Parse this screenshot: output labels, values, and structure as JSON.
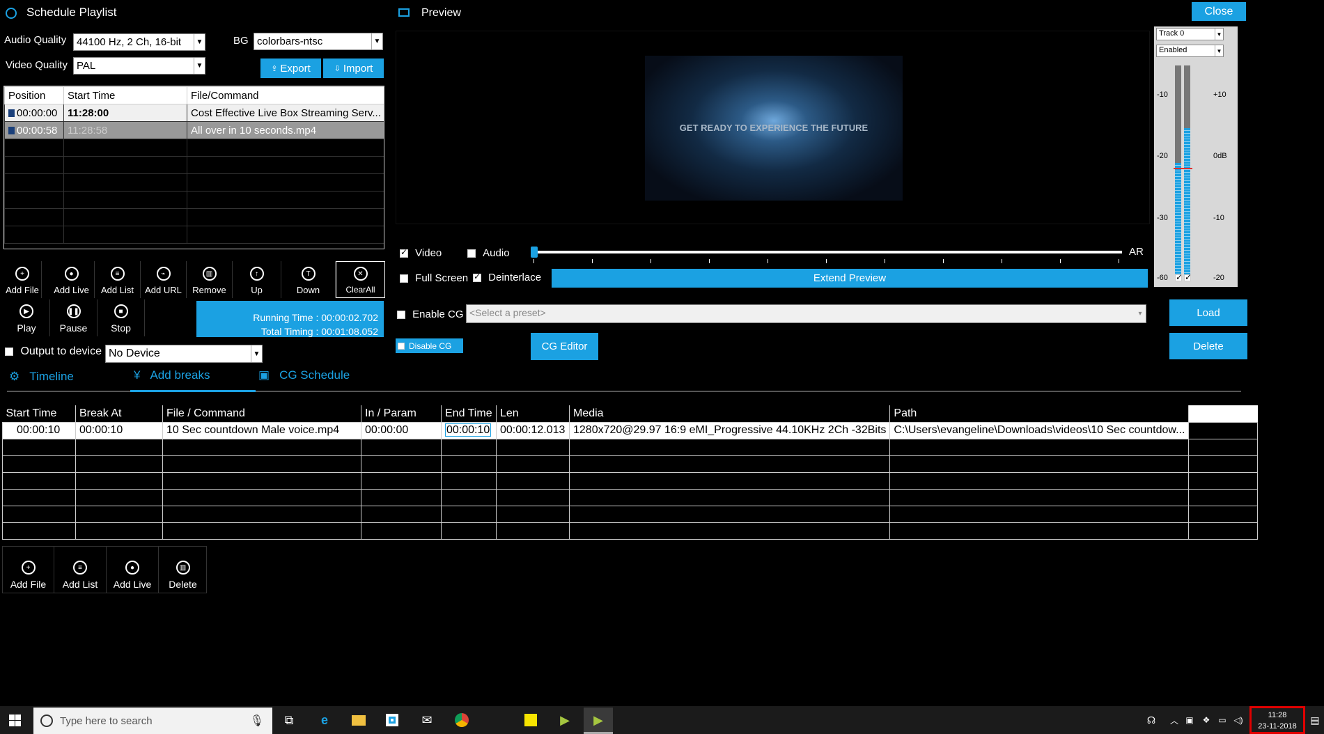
{
  "window": {
    "title": "Schedule Playlist",
    "preview_title": "Preview",
    "close_label": "Close"
  },
  "settings": {
    "audio_quality_label": "Audio Quality",
    "audio_quality_value": "44100 Hz, 2 Ch, 16-bit",
    "bg_label": "BG",
    "bg_value": "colorbars-ntsc",
    "video_quality_label": "Video Quality",
    "video_quality_value": "PAL",
    "export_label": "Export",
    "import_label": "Import"
  },
  "playlist": {
    "columns": [
      "Position",
      "Start Time",
      "File/Command"
    ],
    "rows": [
      {
        "position": "00:00:00",
        "start": "11:28:00",
        "file": "Cost Effective Live Box Streaming Serv..."
      },
      {
        "position": "00:00:58",
        "start": "11:28:58",
        "file": "All over in 10 seconds.mp4"
      }
    ]
  },
  "playlist_tools": [
    "Add File",
    "Add Live",
    "Add List",
    "Add URL",
    "Remove",
    "Up",
    "Down",
    "ClearAll"
  ],
  "transport": [
    "Play",
    "Pause",
    "Stop"
  ],
  "timing": {
    "running": "Running Time : 00:00:02.702",
    "total": "Total Timing : 00:01:08.052"
  },
  "output": {
    "label": "Output to device",
    "device": "No Device"
  },
  "tabs": [
    "Timeline",
    "Add breaks",
    "CG Schedule"
  ],
  "preview": {
    "video_text": "GET READY TO EXPERIENCE THE FUTURE",
    "video_label": "Video",
    "audio_label": "Audio",
    "ar_label": "AR",
    "fullscreen_label": "Full Screen",
    "deinterlace_label": "Deinterlace",
    "extend_preview_label": "Extend Preview",
    "enable_cg_label": "Enable CG",
    "preset_placeholder": "<Select a preset>",
    "disable_cg_label": "Disable CG",
    "cg_editor_label": "CG Editor",
    "load_label": "Load",
    "delete_label": "Delete"
  },
  "meter": {
    "track": "Track 0",
    "enabled": "Enabled",
    "left_scale": [
      "-10",
      "-20",
      "-30",
      "-60"
    ],
    "right_scale": [
      "+10",
      "0dB",
      "-10",
      "-20"
    ]
  },
  "breaks": {
    "columns": [
      "Start Time",
      "Break At",
      "File / Command",
      "In / Param",
      "End Time",
      "Len",
      "Media",
      "Path"
    ],
    "rows": [
      {
        "start": "00:00:10",
        "break_at": "00:00:10",
        "file": "10 Sec countdown Male voice.mp4",
        "in": "00:00:00",
        "end": "00:00:10",
        "len": "00:00:12.013",
        "media": "1280x720@29.97 16:9 eMI_Progressive 44.10KHz 2Ch -32Bits",
        "path": "C:\\Users\\evangeline\\Downloads\\videos\\10 Sec countdow..."
      }
    ]
  },
  "break_tools": [
    "Add File",
    "Add List",
    "Add Live",
    "Delete"
  ],
  "taskbar": {
    "search_placeholder": "Type here to search",
    "time": "11:28",
    "date": "23-11-2018"
  }
}
